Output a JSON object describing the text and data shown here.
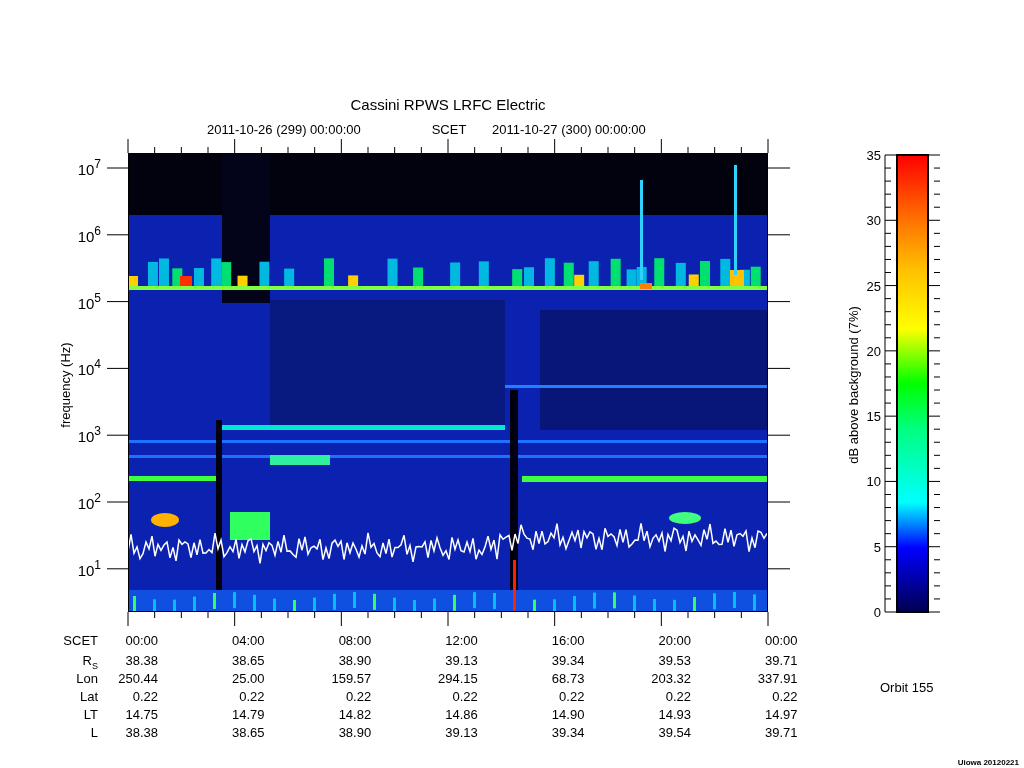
{
  "title": "Cassini RPWS LRFC Electric",
  "subtitle": {
    "start": "2011-10-26 (299) 00:00:00",
    "timescale": "SCET",
    "end": "2011-10-27 (300) 00:00:00"
  },
  "y_axis": {
    "label": "frequency (Hz)",
    "ticks": [
      {
        "base": "10",
        "exponent": "7"
      },
      {
        "base": "10",
        "exponent": "6"
      },
      {
        "base": "10",
        "exponent": "5"
      },
      {
        "base": "10",
        "exponent": "4"
      },
      {
        "base": "10",
        "exponent": "3"
      },
      {
        "base": "10",
        "exponent": "2"
      },
      {
        "base": "10",
        "exponent": "1"
      }
    ]
  },
  "colorbar": {
    "label": "dB above background (7%)",
    "ticks": [
      "35",
      "30",
      "25",
      "20",
      "15",
      "10",
      "5",
      "0"
    ]
  },
  "ephemeris": [
    {
      "label": "SCET",
      "values": [
        "00:00",
        "04:00",
        "08:00",
        "12:00",
        "16:00",
        "20:00",
        "00:00"
      ]
    },
    {
      "label": "R",
      "label_subscript": "S",
      "values": [
        "38.38",
        "38.65",
        "38.90",
        "39.13",
        "39.34",
        "39.53",
        "39.71"
      ]
    },
    {
      "label": "Lon",
      "values": [
        "250.44",
        "25.00",
        "159.57",
        "294.15",
        "68.73",
        "203.32",
        "337.91"
      ]
    },
    {
      "label": "Lat",
      "values": [
        "0.22",
        "0.22",
        "0.22",
        "0.22",
        "0.22",
        "0.22",
        "0.22"
      ]
    },
    {
      "label": "LT",
      "values": [
        "14.75",
        "14.79",
        "14.82",
        "14.86",
        "14.90",
        "14.93",
        "14.97"
      ]
    },
    {
      "label": "L",
      "values": [
        "38.38",
        "38.65",
        "38.90",
        "39.13",
        "39.34",
        "39.54",
        "39.71"
      ]
    }
  ],
  "orbit": "Orbit 155",
  "credit": "Uiowa 20120221"
}
